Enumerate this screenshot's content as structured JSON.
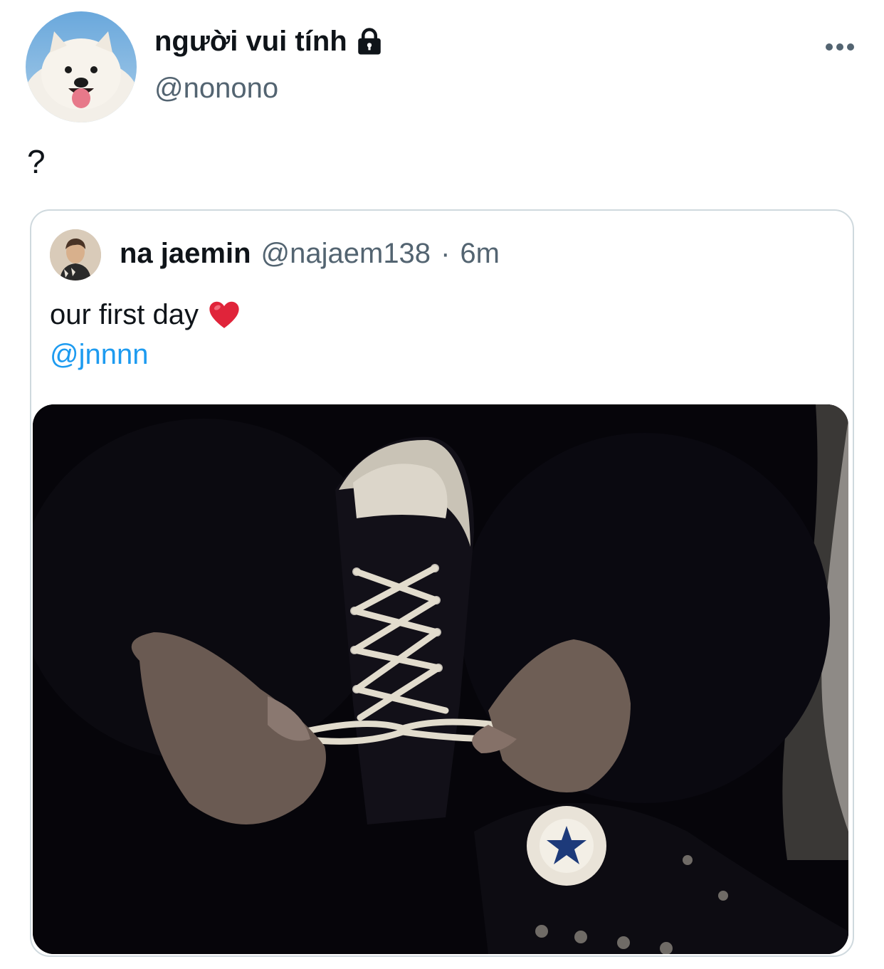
{
  "tweet": {
    "author": {
      "display_name": "người vui tính",
      "handle": "@nonono",
      "avatar_icon": "samoyed-avatar",
      "protected_icon": "lock-icon"
    },
    "more_icon": "more-horizontal-icon",
    "text": "?"
  },
  "quote": {
    "author": {
      "display_name": "na jaemin",
      "handle": "@najaem138",
      "avatar_icon": "person-avatar"
    },
    "separator": "·",
    "time": "6m",
    "text": "our first day",
    "emoji_icon": "red-heart-icon",
    "mention": "@jnnnn",
    "media_icon": "sneakers-photo"
  },
  "colors": {
    "text_primary": "#0f1419",
    "text_secondary": "#536471",
    "link": "#1d9bf0",
    "border": "#cfd9de"
  }
}
